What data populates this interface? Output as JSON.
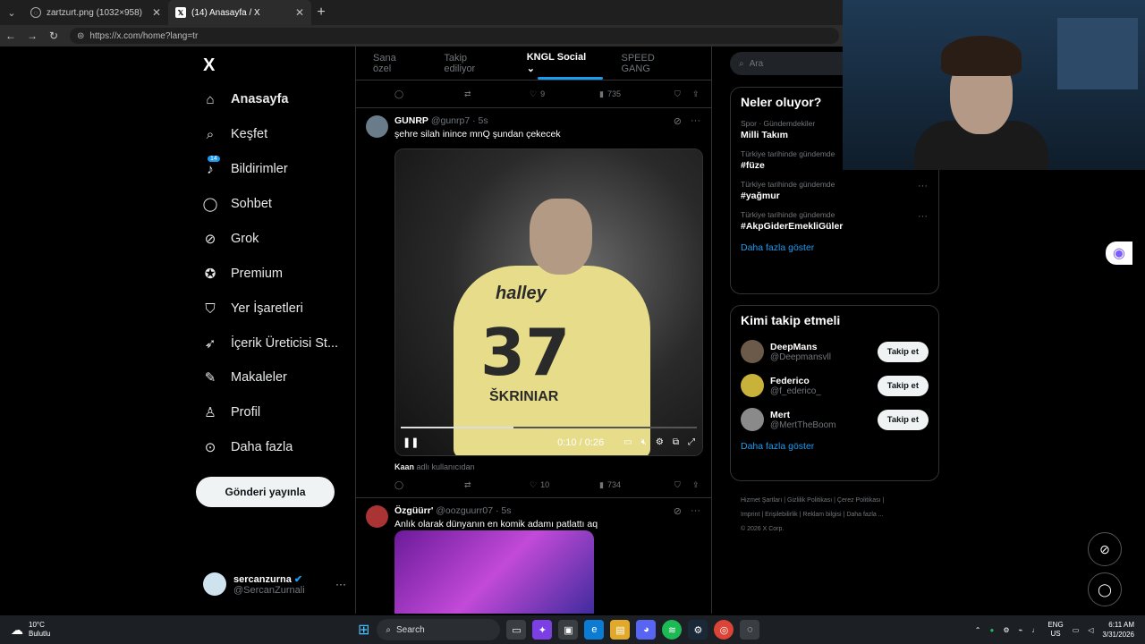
{
  "browser": {
    "tabs": [
      {
        "title": "zartzurt.png (1032×958)"
      },
      {
        "title": "(14) Anasayfa / X"
      }
    ],
    "url_host": "x.com",
    "url_full": "https://x.com/home?lang=tr"
  },
  "nav": {
    "logo": "X",
    "items": [
      {
        "label": "Anasayfa",
        "icon": "home-icon"
      },
      {
        "label": "Keşfet",
        "icon": "search-icon"
      },
      {
        "label": "Bildirimler",
        "icon": "bell-icon",
        "badge": "14"
      },
      {
        "label": "Sohbet",
        "icon": "chat-icon"
      },
      {
        "label": "Grok",
        "icon": "grok-icon"
      },
      {
        "label": "Premium",
        "icon": "premium-icon"
      },
      {
        "label": "Yer İşaretleri",
        "icon": "bookmark-icon"
      },
      {
        "label": "İçerik Üreticisi St...",
        "icon": "rocket-icon"
      },
      {
        "label": "Makaleler",
        "icon": "article-icon"
      },
      {
        "label": "Profil",
        "icon": "person-icon"
      },
      {
        "label": "Daha fazla",
        "icon": "more-circle-icon"
      }
    ],
    "post_button": "Gönderi yayınla",
    "profile": {
      "name": "sercanzurna",
      "handle": "@SercanZurnali"
    }
  },
  "feed": {
    "tabs": [
      "Sana özel",
      "Takip ediliyor",
      "KNGL Social",
      "SPEED GANG"
    ],
    "active_tab": "KNGL Social",
    "top_actions": {
      "likes": "9",
      "views": "735"
    },
    "tweet1": {
      "name": "GUNRP",
      "handle": "@gunrp7",
      "time": "· 5s",
      "text": "şehre silah inince mnQ şundan çekecek",
      "video": {
        "sponsor": "halley",
        "number": "37",
        "player": "ŠKRINIAR",
        "time": "0:10 / 0:26",
        "progress": 0.38
      },
      "credit_user": "Kaan",
      "credit_text": "adlı kullanıcıdan",
      "likes": "10",
      "views": "734"
    },
    "tweet2": {
      "name": "Özgüürr'",
      "handle": "@oozguurr07",
      "time": "· 5s",
      "text": "Anlık olarak dünyanın en komik adamı patlattı aq"
    }
  },
  "sidebar": {
    "search_placeholder": "Ara",
    "trends_title": "Neler oluyor?",
    "trends": [
      {
        "category": "Spor · Gündemdekiler",
        "name": "Milli Takım"
      },
      {
        "category": "Türkiye tarihinde gündemde",
        "name": "#füze"
      },
      {
        "category": "Türkiye tarihinde gündemde",
        "name": "#yağmur"
      },
      {
        "category": "Türkiye tarihinde gündemde",
        "name": "#AkpGiderEmekliGüler"
      }
    ],
    "trends_more": "Daha fazla göster",
    "who_title": "Kimi takip etmeli",
    "who": [
      {
        "name": "DeepMans",
        "handle": "@Deepmansvll",
        "button": "Takip et"
      },
      {
        "name": "Federico",
        "handle": "@f_ederico_",
        "button": "Takip et"
      },
      {
        "name": "Mert",
        "handle": "@MertTheBoom",
        "button": "Takip et"
      }
    ],
    "who_more": "Daha fazla göster",
    "footer": [
      "Hizmet Şartları",
      "Gizlilik Politikası",
      "Çerez Politikası",
      "Imprint",
      "Erişilebilirlik",
      "Reklam bilgisi",
      "Daha fazla ...",
      "© 2026 X Corp."
    ]
  },
  "taskbar": {
    "weather_temp": "10°C",
    "weather_desc": "Bulutlu",
    "search": "Search",
    "lang_top": "ENG",
    "lang_bottom": "US",
    "time": "6:11 AM",
    "date": "3/31/2026"
  },
  "colors": {
    "accent": "#1d9bf0",
    "background": "#000000",
    "border": "#2f3336",
    "muted": "#71767b"
  }
}
